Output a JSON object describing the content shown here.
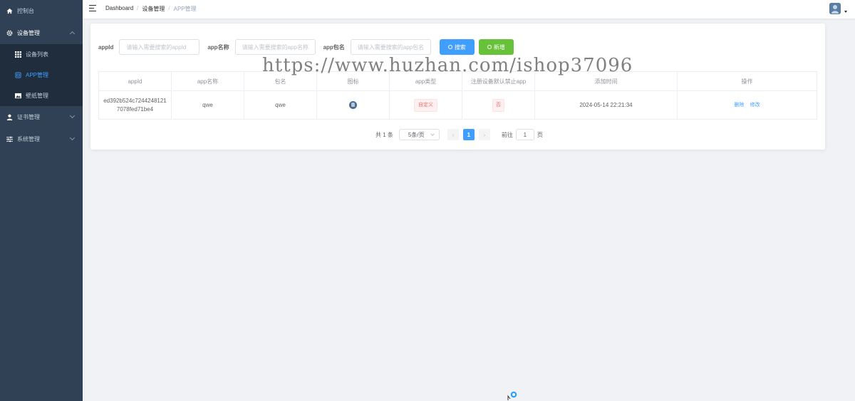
{
  "sidebar": {
    "items": [
      {
        "label": "控制台",
        "icon": "home-icon"
      },
      {
        "label": "设备管理",
        "icon": "gear-icon",
        "expanded": true,
        "children": [
          {
            "label": "设备列表",
            "icon": "grid-icon"
          },
          {
            "label": "APP管理",
            "icon": "app-icon",
            "active": true
          },
          {
            "label": "壁纸管理",
            "icon": "image-icon"
          }
        ]
      },
      {
        "label": "证书管理",
        "icon": "user-icon"
      },
      {
        "label": "系统管理",
        "icon": "sliders-icon"
      }
    ]
  },
  "navbar": {
    "breadcrumb": [
      "Dashboard",
      "设备管理",
      "APP管理"
    ],
    "separator": "/"
  },
  "filters": {
    "appid_label": "appId",
    "appid_placeholder": "请输入需要搜索的appId",
    "appname_label": "app名称",
    "appname_placeholder": "请输入需要搜索的app名称",
    "pkg_label": "app包名",
    "pkg_placeholder": "请输入需要搜索的app包名",
    "search_button": "搜索",
    "add_button": "新增"
  },
  "table": {
    "headers": [
      "appId",
      "app名称",
      "包名",
      "图标",
      "app类型",
      "注册设备默认禁止app",
      "添加时间",
      "操作"
    ],
    "rows": [
      {
        "appid": "ed392b524c7244248121\n7078fed71be4",
        "appid_line1": "ed392b524c7244248121",
        "appid_line2": "7078fed71be4",
        "name": "qwe",
        "pkg": "qwe",
        "type": "自定义",
        "default_block": "否",
        "time": "2024-05-14 22:21:34",
        "action_delete": "删除",
        "action_edit": "修改"
      }
    ]
  },
  "pagination": {
    "total": "共 1 条",
    "page_size": "5条/页",
    "prev": "‹",
    "current": "1",
    "next": "›",
    "goto_label": "前往",
    "goto_value": "1",
    "goto_suffix": "页"
  },
  "watermark": "https://www.huzhan.com/ishop37096",
  "colors": {
    "sidebar_bg": "#304156",
    "submenu_bg": "#1f2d3d",
    "primary": "#409eff",
    "success": "#67c23a",
    "danger": "#f56c6c"
  }
}
